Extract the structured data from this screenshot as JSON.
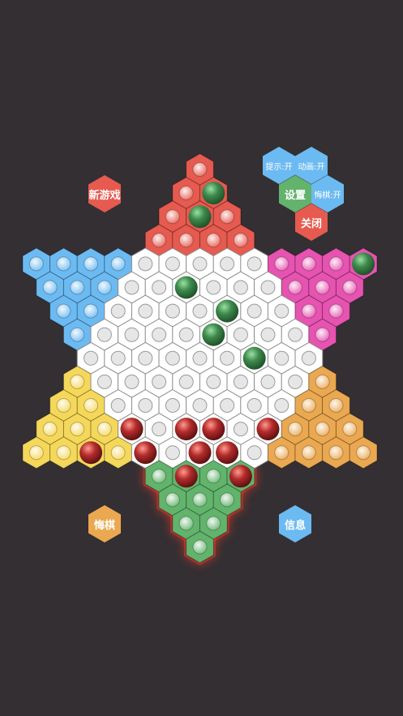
{
  "menu": {
    "new_game": "新游戏",
    "hint": "提示:开",
    "animation": "动画:开",
    "settings": "设置",
    "undo_toggle": "悔棋:开",
    "close": "关闭",
    "undo": "悔棋",
    "info": "信息"
  },
  "colors": {
    "background": "#332f33",
    "top_zone": "#e65a4f",
    "bottom_zone": "#62b36c",
    "upper_left_zone": "#6cbaf2",
    "lower_left_zone": "#f5d85a",
    "upper_right_zone": "#e653b0",
    "lower_right_zone": "#eaa850",
    "center": "#ffffff",
    "green_piece": "#3e8a4c",
    "red_piece": "#b42b2b",
    "active_glow": "#ff3b2b"
  },
  "pieces": {
    "green": [
      [
        0,
        2
      ],
      [
        0,
        3
      ],
      [
        1,
        1
      ],
      [
        2,
        1
      ],
      [
        2,
        3
      ],
      [
        4,
        12
      ],
      [
        5,
        5
      ],
      [
        6,
        6
      ],
      [
        7,
        5
      ],
      [
        8,
        6
      ]
    ],
    "red": [
      [
        11,
        3
      ],
      [
        11,
        5
      ],
      [
        11,
        6
      ],
      [
        11,
        8
      ],
      [
        12,
        2
      ],
      [
        12,
        4
      ],
      [
        12,
        6
      ],
      [
        12,
        7
      ],
      [
        13,
        1
      ],
      [
        13,
        3
      ]
    ]
  }
}
